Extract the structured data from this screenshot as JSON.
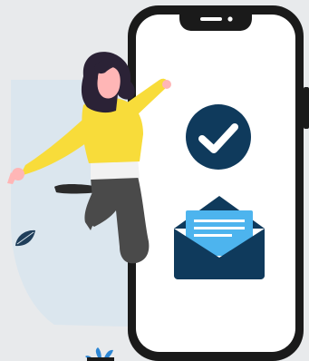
{
  "colors": {
    "page_background": "#e8eaec",
    "backdrop_blob": "#dbe6ee",
    "phone_frame": "#1a1a1a",
    "phone_screen": "#ffffff",
    "notch_slot": "#ffffff",
    "accent_navy": "#0f3a5c",
    "accent_sky": "#4db4ee",
    "sweater_yellow": "#f8dc3a",
    "skin": "#ffb6b6",
    "hair": "#2b2236",
    "pants": "#4a4a4a",
    "shirt_white": "#f2f2f2",
    "shoe": "#2b2b2b",
    "leaf_dark": "#1f3e5a",
    "plant_blue": "#2c86d4"
  },
  "icons": {
    "check": "check-circle-icon",
    "mail": "open-envelope-icon",
    "leaf": "leaf-icon",
    "plant": "potted-plant-icon"
  }
}
